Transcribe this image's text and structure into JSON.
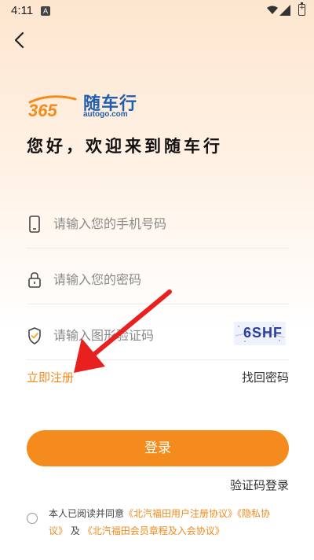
{
  "status_bar": {
    "time": "4:11",
    "notification_icon": "A",
    "icons": [
      "wifi-icon",
      "signal-icon",
      "battery-icon"
    ]
  },
  "header": {
    "back_icon": "chevron-left-icon"
  },
  "logo": {
    "mark_text": "365",
    "name": "随车行",
    "domain": "autogo.com"
  },
  "welcome_text": "您好，欢迎来到随车行",
  "form": {
    "phone_placeholder": "请输入您的手机号码",
    "password_placeholder": "请输入您的密码",
    "captcha_placeholder": "请输入图形验证码",
    "captcha_code": "6SHF"
  },
  "links": {
    "register": "立即注册",
    "forgot_password": "找回密码",
    "sms_login": "验证码登录"
  },
  "login_button": "登录",
  "agreement": {
    "prefix": "本人已阅读并同意",
    "user_agreement": "《北汽福田用户注册协议》",
    "privacy": "《隐私协议》",
    "and": "及",
    "member_rules": "《北汽福田会员章程及入会协议》"
  },
  "colors": {
    "accent": "#f58b1c",
    "brand_blue": "#1f5fae",
    "annotation_red": "#e8201f"
  }
}
